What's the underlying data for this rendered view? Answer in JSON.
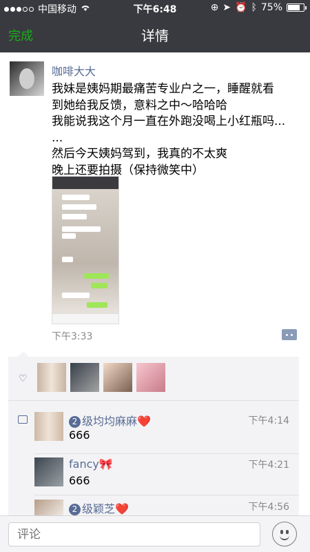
{
  "status": {
    "carrier": "中国移动",
    "time": "下午6:48",
    "battery": "75%",
    "battery_level": 0.75
  },
  "nav": {
    "done_label": "完成",
    "title": "详情"
  },
  "post": {
    "author": "咖啡大大",
    "lines": [
      "我妹是姨妈期最痛苦专业户之一，睡醒就看",
      "到她给我反馈，意料之中～哈哈哈",
      "我能说我这个月一直在外跑没喝上小红瓶吗...",
      "...",
      "然后今天姨妈驾到，我真的不太爽",
      "晚上还要拍摄（保持微笑中）"
    ],
    "time": "下午3:33"
  },
  "comments": [
    {
      "level": "2",
      "name": "级均均麻麻",
      "name_icon": "❤️",
      "time": "下午4:14",
      "text": "666"
    },
    {
      "level": "",
      "name": "fancy",
      "name_icon": "🎀",
      "time": "下午4:21",
      "text": "666"
    },
    {
      "level": "2",
      "name": "级颖芝",
      "name_icon": "❤️",
      "time": "下午4:56",
      "text": ""
    }
  ],
  "input": {
    "placeholder": "评论"
  }
}
